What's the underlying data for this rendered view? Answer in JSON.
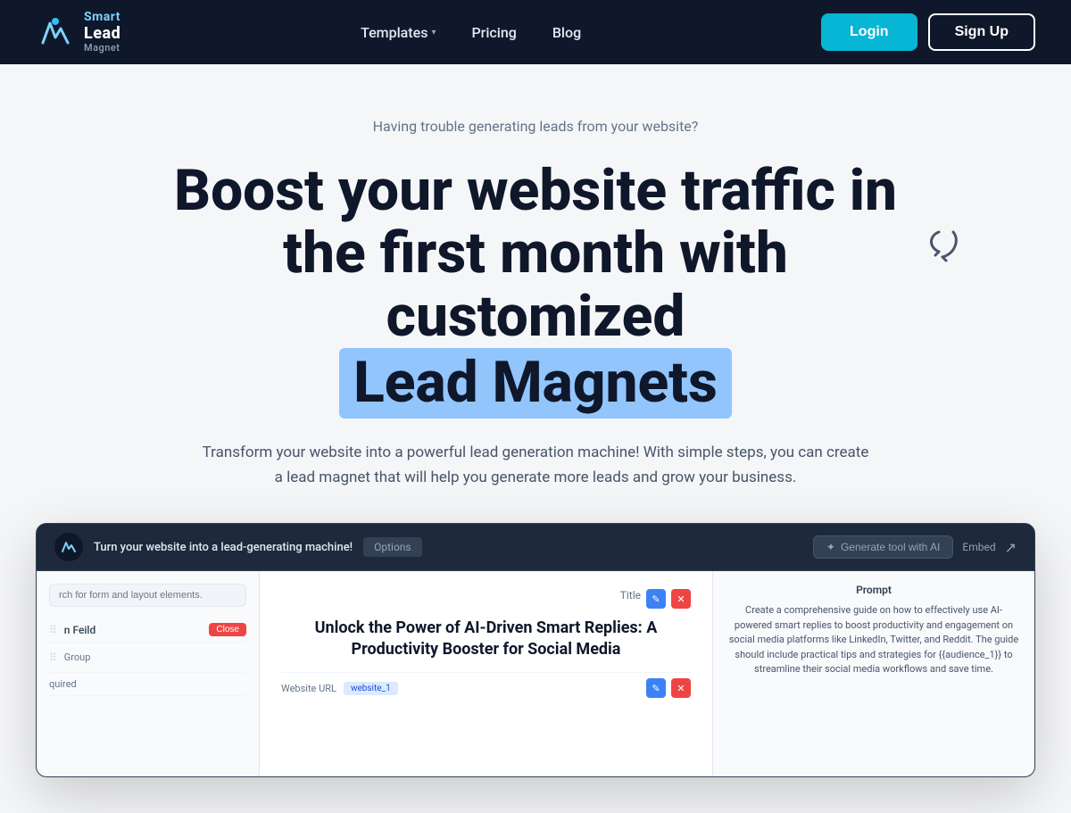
{
  "nav": {
    "logo": {
      "smart": "Smart",
      "lead": "Lead",
      "magnet": "Magnet"
    },
    "links": [
      {
        "id": "templates",
        "label": "Templates",
        "has_dropdown": true
      },
      {
        "id": "pricing",
        "label": "Pricing",
        "has_dropdown": false
      },
      {
        "id": "blog",
        "label": "Blog",
        "has_dropdown": false
      }
    ],
    "login_label": "Login",
    "signup_label": "Sign Up"
  },
  "hero": {
    "subtitle": "Having trouble generating leads from your website?",
    "headline_part1": "Boost your website traffic in the first month with customized",
    "headline_highlight": "Lead Magnets",
    "description": "Transform your website into a powerful lead generation machine! With simple steps, you can create a lead magnet that will help you generate more leads and grow your business."
  },
  "video_preview": {
    "title": "Turn your website into a lead-generating machine!",
    "options_label": "Options",
    "generate_label": "Generate tool with AI",
    "embed_label": "Embed",
    "share_label": "Share",
    "left_panel": {
      "search_placeholder": "rch for form and layout elements.",
      "field_label": "n Feild",
      "close_label": "Close",
      "group_label": "Group",
      "required_label": "quired"
    },
    "center_panel": {
      "title_label": "Title",
      "main_title": "Unlock the Power of AI-Driven Smart Replies: A Productivity Booster for Social Media",
      "url_label": "Website URL",
      "url_chip": "website_1"
    },
    "right_panel": {
      "prompt_label": "Prompt",
      "prompt_text": "Create a comprehensive guide on how to effectively use AI-powered smart replies to boost productivity and engagement on social media platforms like LinkedIn, Twitter, and Reddit. The guide should include practical tips and strategies for {{audience_1}} to streamline their social media workflows and save time."
    }
  },
  "colors": {
    "nav_bg": "#0f172a",
    "hero_bg": "#f5f6f8",
    "accent_cyan": "#06b6d4",
    "accent_blue": "#93c5fd"
  }
}
